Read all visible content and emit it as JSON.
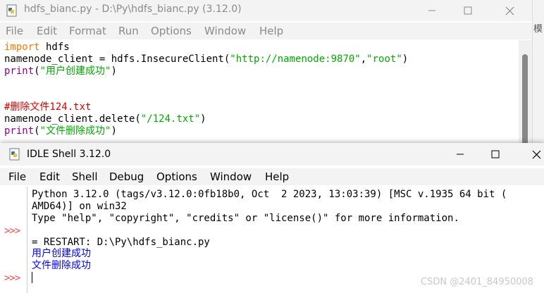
{
  "editor": {
    "title": "hdfs_bianc.py - D:\\Py\\hdfs_bianc.py (3.12.0)",
    "menu": [
      "File",
      "Edit",
      "Format",
      "Run",
      "Options",
      "Window",
      "Help"
    ],
    "code": {
      "l1_kw": "import",
      "l1_rest": " hdfs",
      "l2_a": "namenode_client = hdfs.InsecureClient(",
      "l2_s1": "\"http://namenode:9870\"",
      "l2_b": ",",
      "l2_s2": "\"root\"",
      "l2_c": ")",
      "l3_fn": "print",
      "l3_a": "(",
      "l3_s": "\"用户创建成功\"",
      "l3_b": ")",
      "l4_cmt": "#删除文件124.txt",
      "l5_a": "namenode_client.delete(",
      "l5_s": "\"/124.txt\"",
      "l5_b": ")",
      "l6_fn": "print",
      "l6_a": "(",
      "l6_s": "\"文件删除成功\"",
      "l6_b": ")"
    }
  },
  "side_glyph": "模",
  "shell": {
    "title": "IDLE Shell 3.12.0",
    "menu": [
      "File",
      "Edit",
      "Shell",
      "Debug",
      "Options",
      "Window",
      "Help"
    ],
    "prompt": ">>>",
    "output": {
      "line1": "Python 3.12.0 (tags/v3.12.0:0fb18b0, Oct  2 2023, 13:03:39) [MSC v.1935 64 bit (",
      "line2": "AMD64)] on win32",
      "line3": "Type \"help\", \"copyright\", \"credits\" or \"license()\" for more information.",
      "restart": "= RESTART: D:\\Py\\hdfs_bianc.py",
      "result1": "用户创建成功",
      "result2": "文件删除成功"
    }
  },
  "watermark": "CSDN @2401_84950008",
  "colors": {
    "keyword": "#ff7700",
    "builtin": "#900090",
    "string": "#00aa00",
    "comment": "#dd0000",
    "shell_output": "#0000ff",
    "prompt": "#ff4444"
  }
}
